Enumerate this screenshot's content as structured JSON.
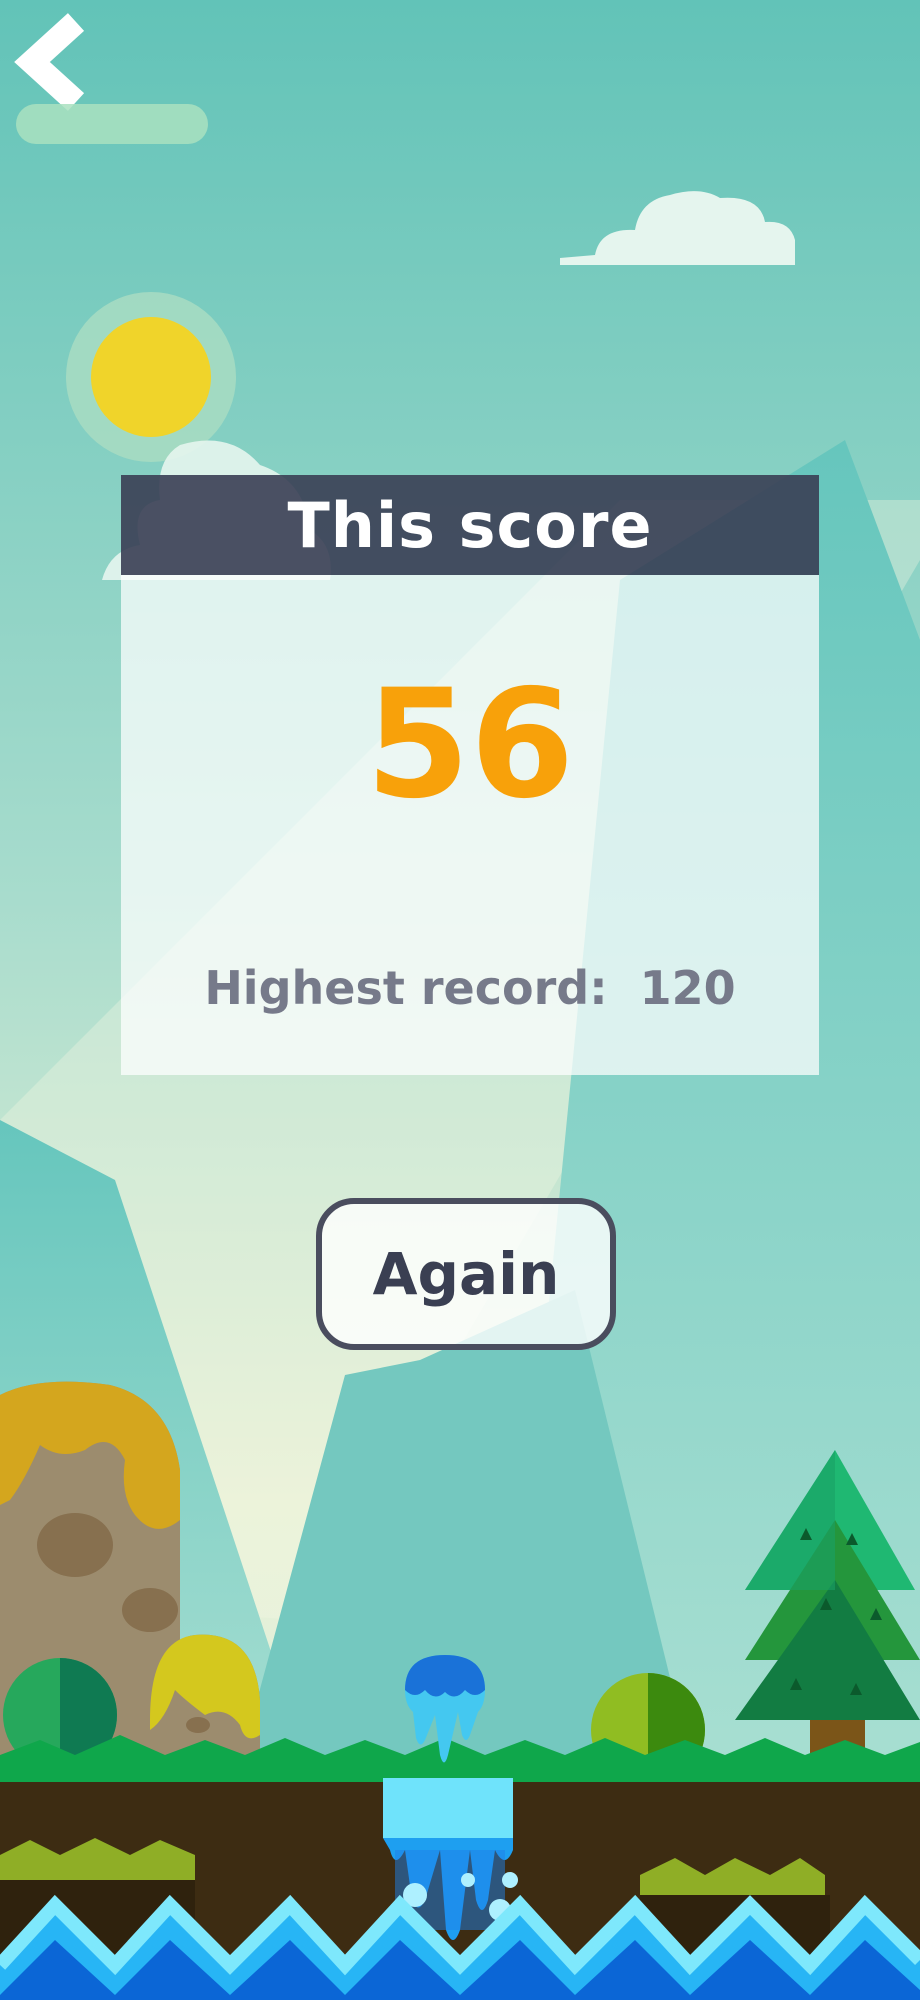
{
  "header": {
    "back_icon": "chevron-left-icon"
  },
  "score_panel": {
    "title": "This score",
    "score": "56",
    "highest_record_label": "Highest record:",
    "highest_record_value": "120"
  },
  "actions": {
    "again_label": "Again"
  },
  "colors": {
    "sky_top": "#62c3b8",
    "sky_bottom": "#e8f1d6",
    "score": "#f8a10a",
    "panel_header": "#3a3e54",
    "record_text": "#767a8a",
    "button_border": "#4a4d5e",
    "sun": "#f0d42a",
    "grass": "#0fa74b",
    "dirt": "#3d2c12",
    "water": "#4fd6f7"
  }
}
